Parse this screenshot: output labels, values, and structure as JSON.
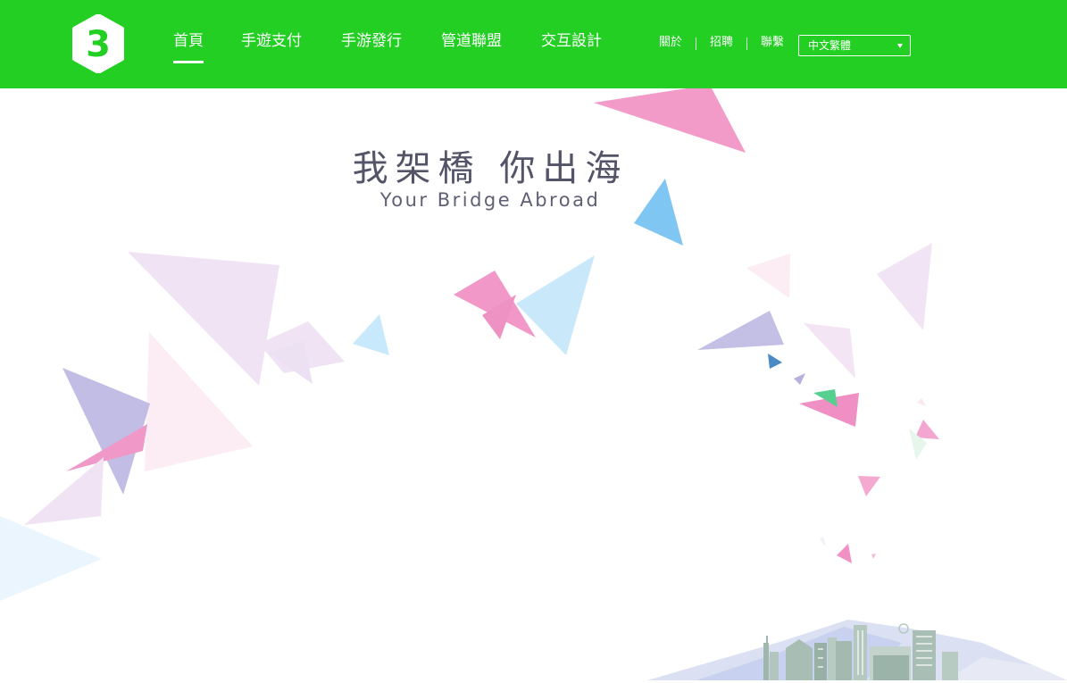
{
  "header": {
    "logo_glyph": "3",
    "nav": [
      {
        "label": "首頁",
        "active": true
      },
      {
        "label": "手遊支付",
        "active": false
      },
      {
        "label": "手游發行",
        "active": false
      },
      {
        "label": "管道聯盟",
        "active": false
      },
      {
        "label": "交互設計",
        "active": false
      }
    ],
    "links": [
      "關於",
      "招聘",
      "聯繫"
    ],
    "language": {
      "selected": "中文繁體"
    }
  },
  "hero": {
    "title": "我架橋 你出海",
    "subtitle": "Your Bridge Abroad"
  },
  "colors": {
    "brand_green": "#22cf22",
    "title_text": "#545468",
    "pink": "#f09bc8",
    "blue": "#7fc4f2",
    "lavender": "#c1bde4",
    "light_blue": "#c8e9fb"
  }
}
